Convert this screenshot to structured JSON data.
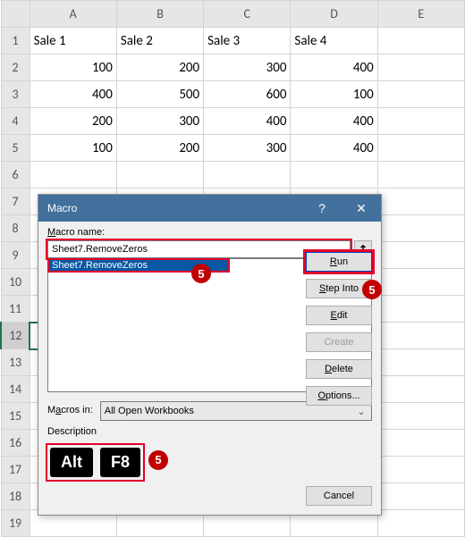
{
  "columns": [
    "A",
    "B",
    "C",
    "D",
    "E"
  ],
  "rows": [
    "1",
    "2",
    "3",
    "4",
    "5",
    "6",
    "7",
    "8",
    "9",
    "10",
    "11",
    "12",
    "13",
    "14",
    "15",
    "16",
    "17",
    "18",
    "19"
  ],
  "headers": {
    "c1": "Sale 1",
    "c2": "Sale 2",
    "c3": "Sale 3",
    "c4": "Sale 4"
  },
  "data": {
    "r2": {
      "A": "100",
      "B": "200",
      "C": "300",
      "D": "400"
    },
    "r3": {
      "A": "400",
      "B": "500",
      "C": "600",
      "D": "100"
    },
    "r4": {
      "A": "200",
      "B": "300",
      "C": "400",
      "D": "400"
    },
    "r5": {
      "A": "100",
      "B": "200",
      "C": "300",
      "D": "400"
    }
  },
  "dialog": {
    "title": "Macro",
    "help_icon": "?",
    "close_icon": "✕",
    "name_label": "Macro name:",
    "name_value": "Sheet7.RemoveZeros",
    "list_item": "Sheet7.RemoveZeros",
    "up_arrow": "↥",
    "macros_in_label": "Macros in:",
    "macros_in_value": "All Open Workbooks",
    "description_label": "Description",
    "buttons": {
      "run": "Run",
      "step": "Step Into",
      "edit": "Edit",
      "create": "Create",
      "delete": "Delete",
      "options": "Options...",
      "cancel": "Cancel"
    },
    "keys": {
      "alt": "Alt",
      "f8": "F8"
    },
    "badge": "5",
    "chevron": "⌄"
  }
}
